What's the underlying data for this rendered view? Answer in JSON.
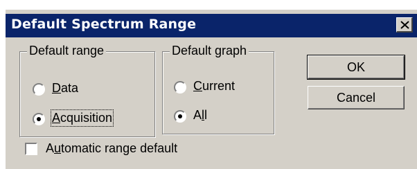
{
  "dialog": {
    "title": "Default Spectrum Range",
    "close_icon": "close-icon"
  },
  "default_range": {
    "label": "Default range",
    "options": [
      {
        "pre": "",
        "accel": "D",
        "post": "ata",
        "selected": false
      },
      {
        "pre": "",
        "accel": "A",
        "post": "cquisition",
        "selected": true
      }
    ]
  },
  "default_graph": {
    "label": "Default graph",
    "options": [
      {
        "pre": "",
        "accel": "C",
        "post": "urrent",
        "selected": false
      },
      {
        "pre": "A",
        "accel": "l",
        "post": "l",
        "selected": true
      }
    ]
  },
  "buttons": {
    "ok": "OK",
    "cancel": "Cancel"
  },
  "automatic_range": {
    "pre": "A",
    "accel": "u",
    "post": "tomatic range default",
    "checked": false
  }
}
